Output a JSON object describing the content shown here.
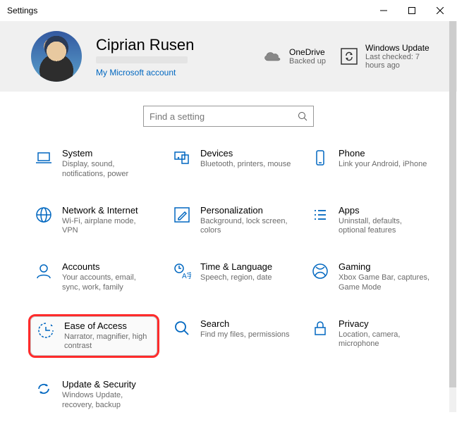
{
  "window": {
    "title": "Settings"
  },
  "header": {
    "user_name": "Ciprian Rusen",
    "account_link": "My Microsoft account",
    "onedrive": {
      "label": "OneDrive",
      "status": "Backed up"
    },
    "update": {
      "label": "Windows Update",
      "status": "Last checked: 7 hours ago"
    }
  },
  "search": {
    "placeholder": "Find a setting"
  },
  "tiles": {
    "system": {
      "title": "System",
      "desc": "Display, sound, notifications, power"
    },
    "devices": {
      "title": "Devices",
      "desc": "Bluetooth, printers, mouse"
    },
    "phone": {
      "title": "Phone",
      "desc": "Link your Android, iPhone"
    },
    "network": {
      "title": "Network & Internet",
      "desc": "Wi-Fi, airplane mode, VPN"
    },
    "personalization": {
      "title": "Personalization",
      "desc": "Background, lock screen, colors"
    },
    "apps": {
      "title": "Apps",
      "desc": "Uninstall, defaults, optional features"
    },
    "accounts": {
      "title": "Accounts",
      "desc": "Your accounts, email, sync, work, family"
    },
    "time": {
      "title": "Time & Language",
      "desc": "Speech, region, date"
    },
    "gaming": {
      "title": "Gaming",
      "desc": "Xbox Game Bar, captures, Game Mode"
    },
    "ease": {
      "title": "Ease of Access",
      "desc": "Narrator, magnifier, high contrast"
    },
    "search": {
      "title": "Search",
      "desc": "Find my files, permissions"
    },
    "privacy": {
      "title": "Privacy",
      "desc": "Location, camera, microphone"
    },
    "updatesec": {
      "title": "Update & Security",
      "desc": "Windows Update, recovery, backup"
    }
  }
}
